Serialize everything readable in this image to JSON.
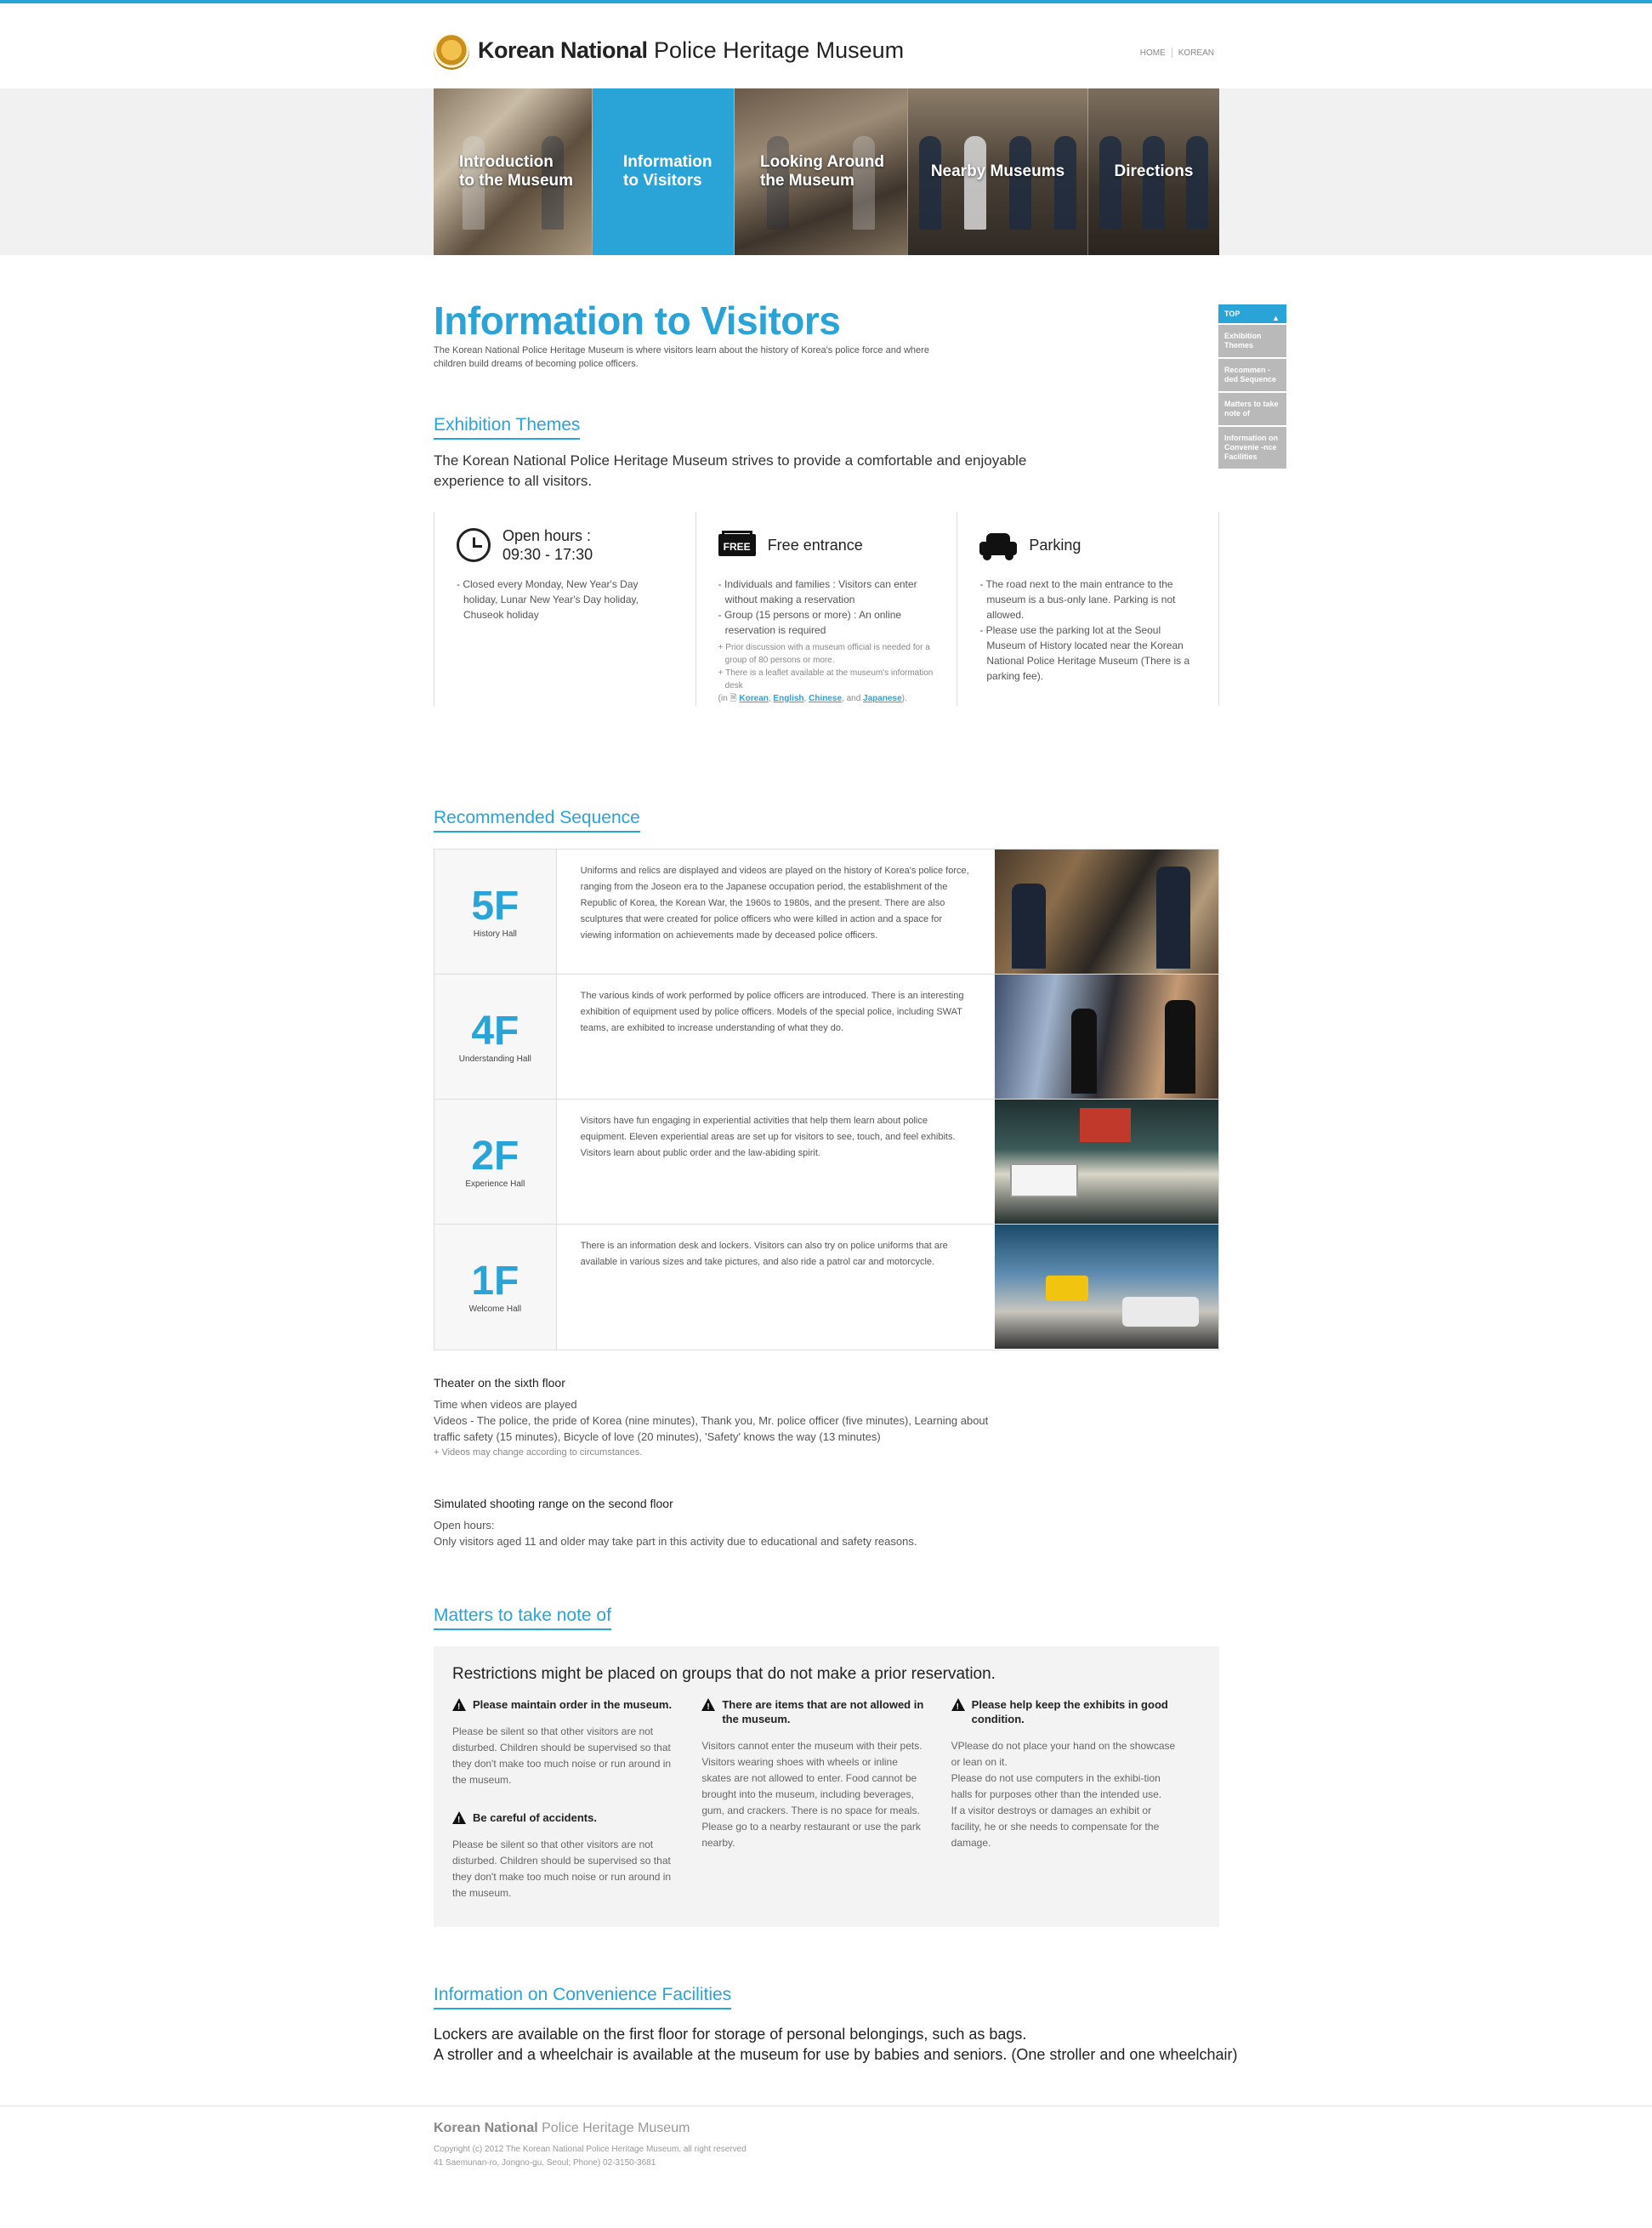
{
  "header": {
    "logo_bold": "Korean National",
    "logo_rest": " Police Heritage Museum",
    "util": [
      "HOME",
      "KOREAN"
    ]
  },
  "nav": [
    {
      "label": "Introduction\nto the Museum"
    },
    {
      "label": "Information\nto Visitors"
    },
    {
      "label": "Looking Around\nthe Museum"
    },
    {
      "label": "Nearby Museums"
    },
    {
      "label": "Directions"
    }
  ],
  "quick_menu": {
    "top": "TOP",
    "items": [
      "Exhibition Themes",
      "Recommen -ded Sequence",
      "Matters to take note of",
      "Information on Convenie -nce Facilities"
    ]
  },
  "page": {
    "title": "Information to Visitors",
    "intro": "The Korean National Police Heritage Museum is where visitors learn about the history of Korea's police force and where children build dreams of becoming police officers."
  },
  "exhibition": {
    "title": "Exhibition Themes",
    "lead": "The Korean National Police Heritage Museum strives to provide a comfortable and enjoyable experience to all visitors.",
    "hours_title": "Open hours :\n09:30 - 17:30",
    "hours_text": "- Closed every Monday, New Year's Day holiday, Lunar New Year's Day holiday, Chuseok holiday",
    "free_icon": "FREE",
    "free_title": "Free entrance",
    "free_p1": "- Individuals and families : Visitors can enter without making a reservation",
    "free_p2": "- Group (15 persons or more) : An online reservation is required",
    "free_n1": "+ Prior discussion with a museum official is needed for a group of 80 persons or more.",
    "free_n2": "+ There is a leaflet available at the museum's information desk",
    "free_n3_pre": "(in ",
    "lang_korean": "Korean",
    "lang_english": "English",
    "lang_chinese": "Chinese",
    "free_and": ", and",
    "lang_japanese": "Japanese",
    "free_n3_post": ").",
    "parking_title": "Parking",
    "parking_p1": "- The road next to the main entrance to the museum is a bus-only lane. Parking is not allowed.",
    "parking_p2": "- Please use the parking lot at the Seoul Museum of History located near the Korean National Police Heritage Museum (There is a parking fee)."
  },
  "recommended": {
    "title": "Recommended Sequence",
    "rows": [
      {
        "floor": "5F",
        "hall": "History Hall",
        "desc": "Uniforms and relics are displayed and videos are played on the history of Korea's police force, ranging from the Joseon era to the Japanese occupation period, the establishment of the Republic of Korea, the Korean War, the 1960s to 1980s, and the present. There are also sculptures that were created for police officers who were killed in action and a space for viewing information on achievements made by deceased police officers."
      },
      {
        "floor": "4F",
        "hall": "Understanding Hall",
        "desc": "The various kinds of work performed by police officers are introduced. There is an interesting exhibition of equipment used by police officers. Models of the special police, including SWAT teams, are exhibited to increase understanding of what they do."
      },
      {
        "floor": "2F",
        "hall": "Experience Hall",
        "desc": "Visitors have fun engaging in experiential activities that help them learn about police equipment. Eleven experiential areas are set up for visitors to see, touch, and feel exhibits. Visitors learn about public order and the law-abiding spirit."
      },
      {
        "floor": "1F",
        "hall": "Welcome Hall",
        "desc": "There is an information desk and lockers. Visitors can also try on police uniforms that are available in various sizes and take pictures, and also ride a patrol car and motorcycle."
      }
    ],
    "theater_title": "Theater on the sixth floor",
    "theater_l1": "Time when videos are played",
    "theater_l2": "Videos - The police, the pride of Korea (nine minutes), Thank you, Mr. police officer (five minutes), Learning about traffic safety (15 minutes), Bicycle of love (20 minutes), 'Safety' knows the way (13 minutes)",
    "theater_note": "+ Videos may change according to circumstances.",
    "shooting_title": "Simulated shooting range on the second floor",
    "shooting_l1": "Open hours:",
    "shooting_l2": "Only visitors aged 11 and older may take part in this activity due to educational and safety reasons."
  },
  "matters": {
    "title": "Matters to take note of",
    "lead": "Restrictions might be placed on groups that do not make a prior reservation.",
    "c1_h1": "Please maintain order in the museum.",
    "c1_t1": "Please be silent so that other visitors are not disturbed. Children should be supervised so that they don't make too much noise or run around in the museum.",
    "c1_h2": "Be careful of accidents.",
    "c1_t2": "Please be silent so that other visitors are not disturbed. Children should be supervised so that they don't make too much noise or run around in the museum.",
    "c2_h": "There are items that are not allowed in the museum.",
    "c2_t": "Visitors cannot enter the museum with their pets. Visitors wearing shoes with wheels or inline skates are not allowed to enter. Food cannot be brought into the museum, including beverages, gum, and crackers. There is no space for meals. Please go to a nearby restaurant or use the park nearby.",
    "c3_h": "Please help keep the exhibits in good condition.",
    "c3_t1": "VPlease do not place your hand on the showcase or lean on it.",
    "c3_t2": "Please do not use computers in the exhibi-tion halls for purposes other than the intended use.",
    "c3_t3": "If a visitor destroys or damages an exhibit or facility, he or she needs to compensate for the damage."
  },
  "facilities": {
    "title": "Information on Convenience Facilities",
    "l1": "Lockers are available on the first floor for storage of personal belongings, such as bags.",
    "l2": "A stroller and a wheelchair is available at the museum for use by babies and seniors. (One stroller and one wheelchair)"
  },
  "footer": {
    "logo_bold": "Korean National",
    "logo_rest": " Police Heritage Museum",
    "copyright": "Copyright (c) 2012 The Korean National Police Heritage Museum. all right reserved",
    "address": "41 Saemunan-ro, Jongno-gu, Seoul; Phone) 02-3150-3681"
  },
  "colors": {
    "accent": "#2aa3d6",
    "nav_active": "#2aa3d6",
    "quick_item": "#b9b9b9",
    "box_bg": "#f3f3f3"
  }
}
